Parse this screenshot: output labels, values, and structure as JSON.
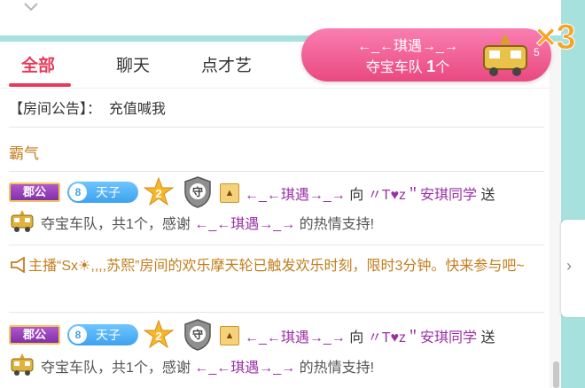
{
  "tabs": [
    {
      "label": "全部",
      "active": true
    },
    {
      "label": "聊天",
      "active": false
    },
    {
      "label": "点才艺",
      "active": false
    }
  ],
  "notice": {
    "label": "【房间公告】：",
    "text": "充值喊我"
  },
  "bawq": "霸气",
  "gift_rows": [
    {
      "badge_jun": "郡公",
      "level_num": "8",
      "level_title": "天子",
      "star_num": "2",
      "guard_label": "守",
      "sender": "←_←琪遇→_→",
      "to": " 向 ",
      "receiver": "〃T♥z＂安琪同学",
      "action": " 送",
      "line2_a": "夺宝车队，共1个，感谢 ",
      "line2_sender": "←_←琪遇→_→",
      "line2_b": " 的热情支持!"
    },
    {
      "badge_jun": "郡公",
      "level_num": "8",
      "level_title": "天子",
      "star_num": "2",
      "guard_label": "守",
      "sender": "←_←琪遇→_→",
      "to": " 向 ",
      "receiver": "〃T♥z＂安琪同学",
      "action": " 送",
      "line2_a": "夺宝车队，共1个，感谢 ",
      "line2_sender": "←_←琪遇→_→",
      "line2_b": " 的热情支持!"
    }
  ],
  "system_message": "主播“Sx☀,,,,苏熙”房间的欢乐摩天轮已触发欢乐时刻，限时3分钟。快来参与吧~",
  "banner": {
    "sender": "←_←琪遇→_→",
    "gift": "夺宝车队 ",
    "count": "1",
    "unit": "个",
    "small_num": "5",
    "multiplier": "×3"
  },
  "colors": {
    "accent": "#e83a5a",
    "purple": "#9c2fa8",
    "gold": "#c27d1c",
    "teal": "#a7e1de"
  }
}
